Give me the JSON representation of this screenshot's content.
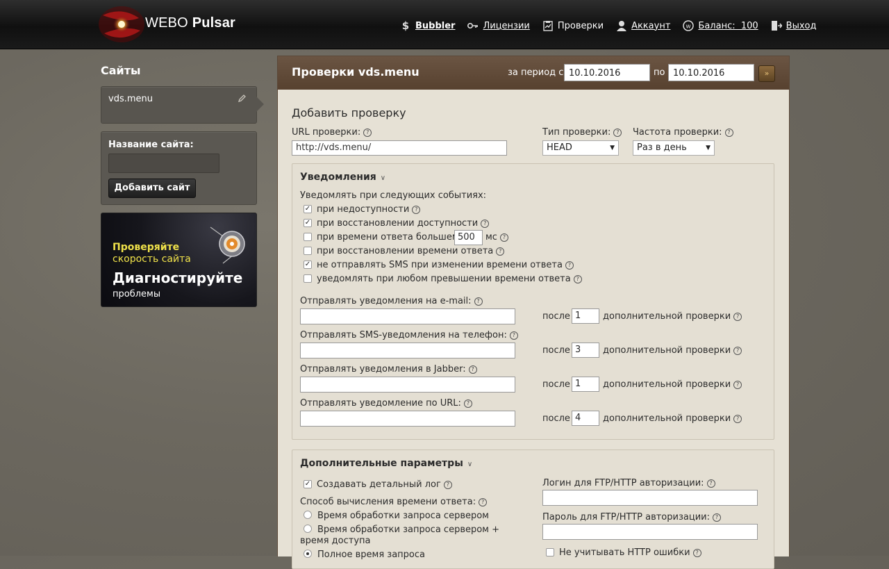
{
  "header": {
    "brand_regular": "WEBO",
    "brand_bold": "Pulsar",
    "nav": [
      {
        "icon": "dollar-icon",
        "label": "Bubbler"
      },
      {
        "icon": "key-icon",
        "label": "Лицензии"
      },
      {
        "icon": "checklist-icon",
        "label": "Проверки"
      },
      {
        "icon": "user-icon",
        "label": "Аккаунт"
      },
      {
        "icon": "webo-coin-icon",
        "label": "Баланс:  100"
      },
      {
        "icon": "exit-icon",
        "label": "Выход"
      }
    ]
  },
  "sidebar": {
    "title": "Сайты",
    "site": "vds.menu",
    "add_label": "Название сайта:",
    "add_value": "",
    "add_button": "Добавить сайт",
    "banner": {
      "line1": "Проверяйте",
      "line2": "скорость сайта",
      "line3": "Диагностируйте",
      "line4": "проблемы"
    }
  },
  "main": {
    "title": "Проверки vds.menu",
    "period_from_label": "за период с",
    "period_to_label": "по",
    "date_from": "10.10.2016",
    "date_to": "10.10.2016",
    "add_check_title": "Добавить проверку",
    "url_label": "URL проверки:",
    "url_value": "http://vds.menu/",
    "type_label": "Тип проверки:",
    "type_value": "HEAD",
    "freq_label": "Частота проверки:",
    "freq_value": "Раз в день"
  },
  "notifications": {
    "title": "Уведомления",
    "events_label": "Уведомлять при следующих событиях:",
    "events": [
      {
        "label": "при недоступности",
        "checked": true
      },
      {
        "label": "при восстановлении доступности",
        "checked": true
      },
      {
        "label": "при времени ответа большем",
        "checked": false,
        "value": "500",
        "unit": "мс"
      },
      {
        "label": "при восстановлении времени ответа",
        "checked": false
      },
      {
        "label": "не отправлять SMS при изменении времени ответа",
        "checked": true
      },
      {
        "label": "уведомлять при любом превышении времени ответа",
        "checked": false
      }
    ],
    "channels": [
      {
        "label": "Отправлять уведомления на e-mail:",
        "value": "",
        "after": "после",
        "count": "1",
        "suffix": "дополнительной проверки"
      },
      {
        "label": "Отправлять SMS-уведомления на телефон:",
        "value": "",
        "after": "после",
        "count": "3",
        "suffix": "дополнительной проверки"
      },
      {
        "label": "Отправлять уведомления в Jabber:",
        "value": "",
        "after": "после",
        "count": "1",
        "suffix": "дополнительной проверки"
      },
      {
        "label": "Отправлять уведомление по URL:",
        "value": "",
        "after": "после",
        "count": "4",
        "suffix": "дополнительной проверки"
      }
    ]
  },
  "extra": {
    "title": "Дополнительные параметры",
    "detailed_log": "Создавать детальный лог",
    "detailed_log_checked": true,
    "method_label": "Способ вычисления времени ответа:",
    "methods": [
      {
        "label": "Время обработки запроса сервером",
        "selected": false
      },
      {
        "label": "Время обработки запроса сервером + время доступа",
        "selected": false
      },
      {
        "label": "Полное время запроса",
        "selected": true
      }
    ],
    "login_label": "Логин для FTP/HTTP авторизации:",
    "password_label": "Пароль для FTP/HTTP авторизации:",
    "ignore_errors": "Не учитывать HTTP ошибки",
    "ignore_errors_checked": false
  }
}
